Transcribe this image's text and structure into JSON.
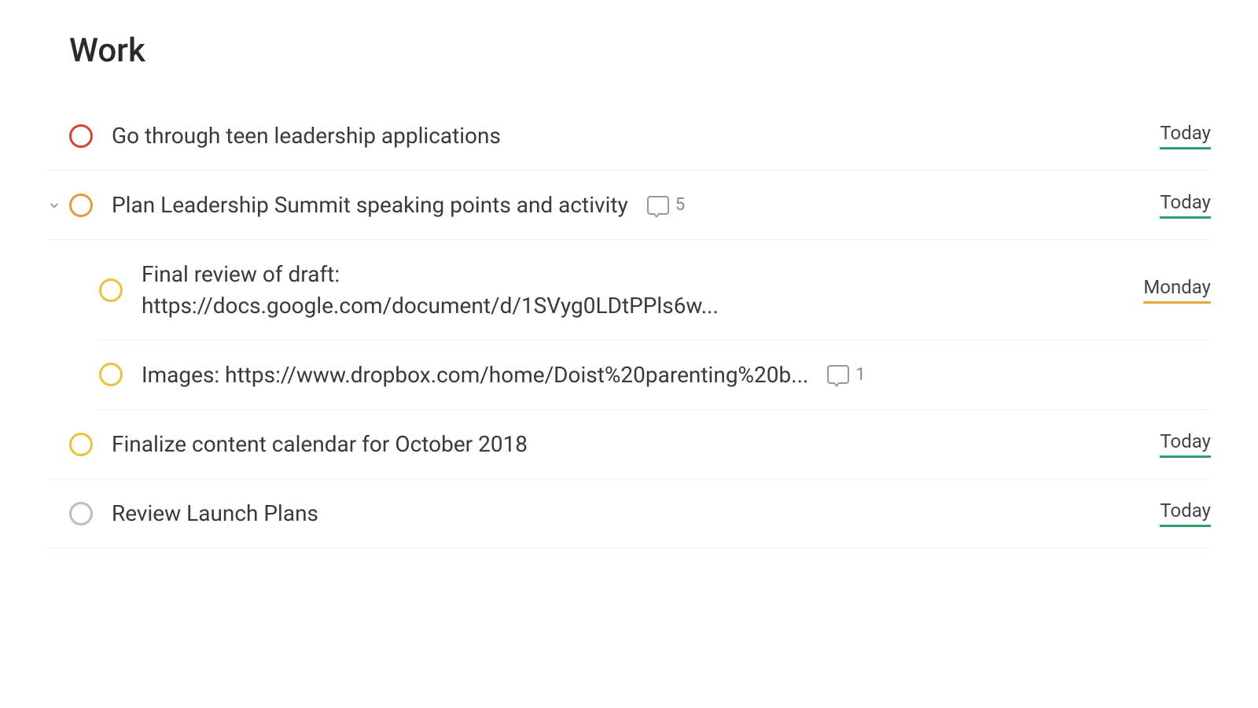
{
  "project": {
    "title": "Work"
  },
  "tasks": [
    {
      "text": "Go through teen leadership applications",
      "priority": "red",
      "due": "Today",
      "due_class": "today",
      "comments": null,
      "expandable": false
    },
    {
      "text": "Plan Leadership Summit speaking points and activity",
      "priority": "orange",
      "due": "Today",
      "due_class": "today",
      "comments": "5",
      "expandable": true
    },
    {
      "text": "Final review of draft: https://docs.google.com/document/d/1SVyg0LDtPPls6w...",
      "priority": "yellow",
      "due": "Monday",
      "due_class": "monday",
      "comments": null,
      "subtask": true
    },
    {
      "text": "Images: https://www.dropbox.com/home/Doist%20parenting%20b...",
      "priority": "yellow",
      "due": null,
      "comments": "1",
      "subtask": true
    },
    {
      "text": "Finalize content calendar for October 2018",
      "priority": "yellow",
      "due": "Today",
      "due_class": "today",
      "comments": null
    },
    {
      "text": "Review Launch Plans",
      "priority": "gray",
      "due": "Today",
      "due_class": "today",
      "comments": null
    }
  ]
}
